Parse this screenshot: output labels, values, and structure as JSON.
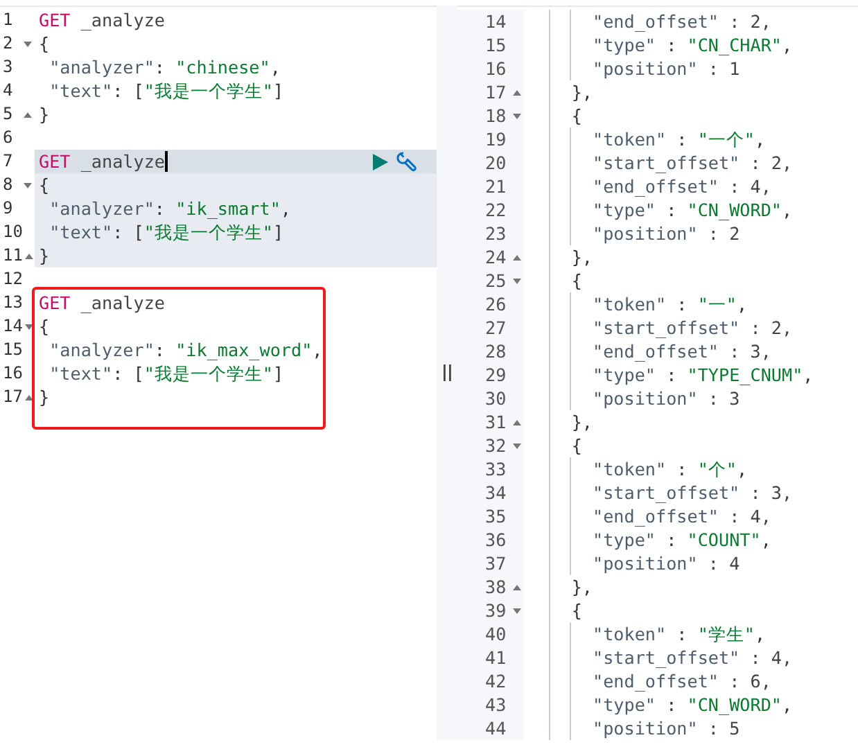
{
  "request_editor": {
    "blocks": [
      {
        "kind": "request",
        "selected": false,
        "highlighted": false,
        "lines": [
          {
            "number": "1",
            "kind": "plain",
            "segments": [
              {
                "text": "GET",
                "kind": "method"
              },
              {
                "text": " _analyze",
                "kind": "path"
              }
            ]
          },
          {
            "number": "2",
            "kind": "fold_start",
            "segments": [
              {
                "text": "{",
                "kind": "punct"
              }
            ]
          },
          {
            "number": "3",
            "kind": "plain",
            "segments": [
              {
                "text": " \"analyzer\"",
                "kind": "key"
              },
              {
                "text": ": ",
                "kind": "punct"
              },
              {
                "text": "\"chinese\"",
                "kind": "string"
              },
              {
                "text": ",",
                "kind": "punct"
              }
            ]
          },
          {
            "number": "4",
            "kind": "plain",
            "segments": [
              {
                "text": " \"text\"",
                "kind": "key"
              },
              {
                "text": ": [",
                "kind": "punct"
              },
              {
                "text": "\"我是一个学生\"",
                "kind": "string"
              },
              {
                "text": "]",
                "kind": "punct"
              }
            ]
          },
          {
            "number": "5",
            "kind": "fold_end",
            "segments": [
              {
                "text": "}",
                "kind": "punct"
              }
            ]
          }
        ]
      },
      {
        "kind": "blank",
        "lines": [
          {
            "number": "6",
            "kind": "plain"
          }
        ]
      },
      {
        "kind": "request",
        "selected": true,
        "highlighted": false,
        "lines": [
          {
            "number": "7",
            "kind": "plain",
            "cursor": true,
            "segments": [
              {
                "text": "GET",
                "kind": "method"
              },
              {
                "text": " _analyze",
                "kind": "path"
              }
            ]
          },
          {
            "number": "8",
            "kind": "fold_start",
            "segments": [
              {
                "text": "{",
                "kind": "punct"
              }
            ]
          },
          {
            "number": "9",
            "kind": "plain",
            "segments": [
              {
                "text": " \"analyzer\"",
                "kind": "key"
              },
              {
                "text": ": ",
                "kind": "punct"
              },
              {
                "text": "\"ik_smart\"",
                "kind": "string"
              },
              {
                "text": ",",
                "kind": "punct"
              }
            ]
          },
          {
            "number": "10",
            "kind": "plain",
            "segments": [
              {
                "text": " \"text\"",
                "kind": "key"
              },
              {
                "text": ": [",
                "kind": "punct"
              },
              {
                "text": "\"我是一个学生\"",
                "kind": "string"
              },
              {
                "text": "]",
                "kind": "punct"
              }
            ]
          },
          {
            "number": "11",
            "kind": "fold_end",
            "segments": [
              {
                "text": "}",
                "kind": "punct"
              }
            ]
          }
        ]
      },
      {
        "kind": "blank",
        "lines": [
          {
            "number": "12",
            "kind": "plain"
          }
        ]
      },
      {
        "kind": "request",
        "selected": false,
        "highlighted": true,
        "lines": [
          {
            "number": "13",
            "kind": "plain",
            "segments": [
              {
                "text": "GET",
                "kind": "method"
              },
              {
                "text": " _analyze",
                "kind": "path"
              }
            ]
          },
          {
            "number": "14",
            "kind": "fold_start",
            "segments": [
              {
                "text": "{",
                "kind": "punct"
              }
            ]
          },
          {
            "number": "15",
            "kind": "plain",
            "segments": [
              {
                "text": " \"analyzer\"",
                "kind": "key"
              },
              {
                "text": ": ",
                "kind": "punct"
              },
              {
                "text": "\"ik_max_word\"",
                "kind": "string"
              },
              {
                "text": ",",
                "kind": "punct"
              }
            ]
          },
          {
            "number": "16",
            "kind": "plain",
            "segments": [
              {
                "text": " \"text\"",
                "kind": "key"
              },
              {
                "text": ": [",
                "kind": "punct"
              },
              {
                "text": "\"我是一个学生\"",
                "kind": "string"
              },
              {
                "text": "]",
                "kind": "punct"
              }
            ]
          },
          {
            "number": "17",
            "kind": "fold_end",
            "segments": [
              {
                "text": "}",
                "kind": "punct"
              }
            ]
          }
        ]
      }
    ]
  },
  "response_viewer": {
    "lines": [
      {
        "number": "14",
        "kind": "plain",
        "segments": [
          {
            "text": "      \"end_offset\"",
            "kind": "key"
          },
          {
            "text": " : 2,",
            "kind": "number"
          }
        ]
      },
      {
        "number": "15",
        "kind": "plain",
        "segments": [
          {
            "text": "      \"type\"",
            "kind": "key"
          },
          {
            "text": " : ",
            "kind": "punct"
          },
          {
            "text": "\"CN_CHAR\"",
            "kind": "string"
          },
          {
            "text": ",",
            "kind": "punct"
          }
        ]
      },
      {
        "number": "16",
        "kind": "plain",
        "segments": [
          {
            "text": "      \"position\"",
            "kind": "key"
          },
          {
            "text": " : 1",
            "kind": "number"
          }
        ]
      },
      {
        "number": "17",
        "kind": "fold_end",
        "segments": [
          {
            "text": "    },",
            "kind": "punct"
          }
        ]
      },
      {
        "number": "18",
        "kind": "fold_start",
        "segments": [
          {
            "text": "    {",
            "kind": "punct"
          }
        ]
      },
      {
        "number": "19",
        "kind": "plain",
        "segments": [
          {
            "text": "      \"token\"",
            "kind": "key"
          },
          {
            "text": " : ",
            "kind": "punct"
          },
          {
            "text": "\"一个\"",
            "kind": "string"
          },
          {
            "text": ",",
            "kind": "punct"
          }
        ]
      },
      {
        "number": "20",
        "kind": "plain",
        "segments": [
          {
            "text": "      \"start_offset\"",
            "kind": "key"
          },
          {
            "text": " : 2,",
            "kind": "number"
          }
        ]
      },
      {
        "number": "21",
        "kind": "plain",
        "segments": [
          {
            "text": "      \"end_offset\"",
            "kind": "key"
          },
          {
            "text": " : 4,",
            "kind": "number"
          }
        ]
      },
      {
        "number": "22",
        "kind": "plain",
        "segments": [
          {
            "text": "      \"type\"",
            "kind": "key"
          },
          {
            "text": " : ",
            "kind": "punct"
          },
          {
            "text": "\"CN_WORD\"",
            "kind": "string"
          },
          {
            "text": ",",
            "kind": "punct"
          }
        ]
      },
      {
        "number": "23",
        "kind": "plain",
        "segments": [
          {
            "text": "      \"position\"",
            "kind": "key"
          },
          {
            "text": " : 2",
            "kind": "number"
          }
        ]
      },
      {
        "number": "24",
        "kind": "fold_end",
        "segments": [
          {
            "text": "    },",
            "kind": "punct"
          }
        ]
      },
      {
        "number": "25",
        "kind": "fold_start",
        "segments": [
          {
            "text": "    {",
            "kind": "punct"
          }
        ]
      },
      {
        "number": "26",
        "kind": "plain",
        "segments": [
          {
            "text": "      \"token\"",
            "kind": "key"
          },
          {
            "text": " : ",
            "kind": "punct"
          },
          {
            "text": "\"一\"",
            "kind": "string"
          },
          {
            "text": ",",
            "kind": "punct"
          }
        ]
      },
      {
        "number": "27",
        "kind": "plain",
        "segments": [
          {
            "text": "      \"start_offset\"",
            "kind": "key"
          },
          {
            "text": " : 2,",
            "kind": "number"
          }
        ]
      },
      {
        "number": "28",
        "kind": "plain",
        "segments": [
          {
            "text": "      \"end_offset\"",
            "kind": "key"
          },
          {
            "text": " : 3,",
            "kind": "number"
          }
        ]
      },
      {
        "number": "29",
        "kind": "plain",
        "segments": [
          {
            "text": "      \"type\"",
            "kind": "key"
          },
          {
            "text": " : ",
            "kind": "punct"
          },
          {
            "text": "\"TYPE_CNUM\"",
            "kind": "string"
          },
          {
            "text": ",",
            "kind": "punct"
          }
        ]
      },
      {
        "number": "30",
        "kind": "plain",
        "segments": [
          {
            "text": "      \"position\"",
            "kind": "key"
          },
          {
            "text": " : 3",
            "kind": "number"
          }
        ]
      },
      {
        "number": "31",
        "kind": "fold_end",
        "segments": [
          {
            "text": "    },",
            "kind": "punct"
          }
        ]
      },
      {
        "number": "32",
        "kind": "fold_start",
        "segments": [
          {
            "text": "    {",
            "kind": "punct"
          }
        ]
      },
      {
        "number": "33",
        "kind": "plain",
        "segments": [
          {
            "text": "      \"token\"",
            "kind": "key"
          },
          {
            "text": " : ",
            "kind": "punct"
          },
          {
            "text": "\"个\"",
            "kind": "string"
          },
          {
            "text": ",",
            "kind": "punct"
          }
        ]
      },
      {
        "number": "34",
        "kind": "plain",
        "segments": [
          {
            "text": "      \"start_offset\"",
            "kind": "key"
          },
          {
            "text": " : 3,",
            "kind": "number"
          }
        ]
      },
      {
        "number": "35",
        "kind": "plain",
        "segments": [
          {
            "text": "      \"end_offset\"",
            "kind": "key"
          },
          {
            "text": " : 4,",
            "kind": "number"
          }
        ]
      },
      {
        "number": "36",
        "kind": "plain",
        "segments": [
          {
            "text": "      \"type\"",
            "kind": "key"
          },
          {
            "text": " : ",
            "kind": "punct"
          },
          {
            "text": "\"COUNT\"",
            "kind": "string"
          },
          {
            "text": ",",
            "kind": "punct"
          }
        ]
      },
      {
        "number": "37",
        "kind": "plain",
        "segments": [
          {
            "text": "      \"position\"",
            "kind": "key"
          },
          {
            "text": " : 4",
            "kind": "number"
          }
        ]
      },
      {
        "number": "38",
        "kind": "fold_end",
        "segments": [
          {
            "text": "    },",
            "kind": "punct"
          }
        ]
      },
      {
        "number": "39",
        "kind": "fold_start",
        "segments": [
          {
            "text": "    {",
            "kind": "punct"
          }
        ]
      },
      {
        "number": "40",
        "kind": "plain",
        "segments": [
          {
            "text": "      \"token\"",
            "kind": "key"
          },
          {
            "text": " : ",
            "kind": "punct"
          },
          {
            "text": "\"学生\"",
            "kind": "string"
          },
          {
            "text": ",",
            "kind": "punct"
          }
        ]
      },
      {
        "number": "41",
        "kind": "plain",
        "segments": [
          {
            "text": "      \"start_offset\"",
            "kind": "key"
          },
          {
            "text": " : 4,",
            "kind": "number"
          }
        ]
      },
      {
        "number": "42",
        "kind": "plain",
        "segments": [
          {
            "text": "      \"end_offset\"",
            "kind": "key"
          },
          {
            "text": " : 6,",
            "kind": "number"
          }
        ]
      },
      {
        "number": "43",
        "kind": "plain",
        "segments": [
          {
            "text": "      \"type\"",
            "kind": "key"
          },
          {
            "text": " : ",
            "kind": "punct"
          },
          {
            "text": "\"CN_WORD\"",
            "kind": "string"
          },
          {
            "text": ",",
            "kind": "punct"
          }
        ]
      },
      {
        "number": "44",
        "kind": "plain",
        "segments": [
          {
            "text": "      \"position\"",
            "kind": "key"
          },
          {
            "text": " : 5",
            "kind": "number"
          }
        ]
      }
    ]
  }
}
